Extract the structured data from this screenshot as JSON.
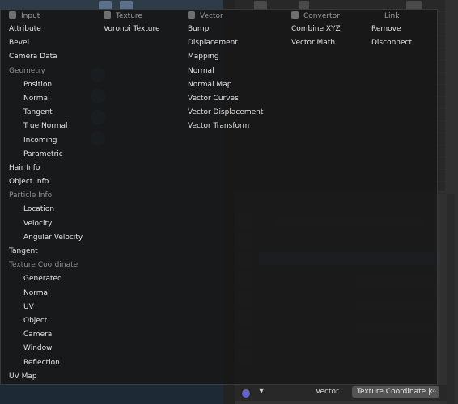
{
  "menu": {
    "columns": [
      {
        "header": "Input",
        "items": [
          {
            "label": "Attribute",
            "kind": "item"
          },
          {
            "label": "Bevel",
            "kind": "item"
          },
          {
            "label": "Camera Data",
            "kind": "item"
          },
          {
            "label": "Geometry",
            "kind": "subheader"
          },
          {
            "label": "Position",
            "kind": "indented"
          },
          {
            "label": "Normal",
            "kind": "indented"
          },
          {
            "label": "Tangent",
            "kind": "indented"
          },
          {
            "label": "True Normal",
            "kind": "indented"
          },
          {
            "label": "Incoming",
            "kind": "indented"
          },
          {
            "label": "Parametric",
            "kind": "indented"
          },
          {
            "label": "Hair Info",
            "kind": "item"
          },
          {
            "label": "Object Info",
            "kind": "item"
          },
          {
            "label": "Particle Info",
            "kind": "subheader"
          },
          {
            "label": "Location",
            "kind": "indented"
          },
          {
            "label": "Velocity",
            "kind": "indented"
          },
          {
            "label": "Angular Velocity",
            "kind": "indented"
          },
          {
            "label": "Tangent",
            "kind": "item"
          },
          {
            "label": "Texture Coordinate",
            "kind": "subheader"
          },
          {
            "label": "Generated",
            "kind": "indented"
          },
          {
            "label": "Normal",
            "kind": "indented"
          },
          {
            "label": "UV",
            "kind": "indented"
          },
          {
            "label": "Object",
            "kind": "indented"
          },
          {
            "label": "Camera",
            "kind": "indented"
          },
          {
            "label": "Window",
            "kind": "indented"
          },
          {
            "label": "Reflection",
            "kind": "indented"
          },
          {
            "label": "UV Map",
            "kind": "item"
          }
        ]
      },
      {
        "header": "Texture",
        "items": [
          {
            "label": "Voronoi Texture",
            "kind": "item"
          }
        ]
      },
      {
        "header": "Vector",
        "items": [
          {
            "label": "Bump",
            "kind": "item"
          },
          {
            "label": "Displacement",
            "kind": "item"
          },
          {
            "label": "Mapping",
            "kind": "item"
          },
          {
            "label": "Normal",
            "kind": "item"
          },
          {
            "label": "Normal Map",
            "kind": "item"
          },
          {
            "label": "Vector Curves",
            "kind": "item"
          },
          {
            "label": "Vector Displacement",
            "kind": "item"
          },
          {
            "label": "Vector Transform",
            "kind": "item"
          }
        ]
      },
      {
        "header": "Convertor",
        "items": [
          {
            "label": "Combine XYZ",
            "kind": "item"
          },
          {
            "label": "Vector Math",
            "kind": "item"
          }
        ]
      },
      {
        "header": "Link",
        "items": [
          {
            "label": "Remove",
            "kind": "item"
          },
          {
            "label": "Disconnect",
            "kind": "item"
          }
        ]
      }
    ]
  },
  "socket_row": {
    "label": "Vector",
    "value": "Texture Coordinate | ..",
    "clear_symbol": "⊙"
  },
  "colors": {
    "menu_bg": "#161616",
    "header_text": "#9b9b9b",
    "item_text": "#e2e2e2",
    "subheader_text": "#8e8e8e",
    "socket": "#6363c7"
  }
}
